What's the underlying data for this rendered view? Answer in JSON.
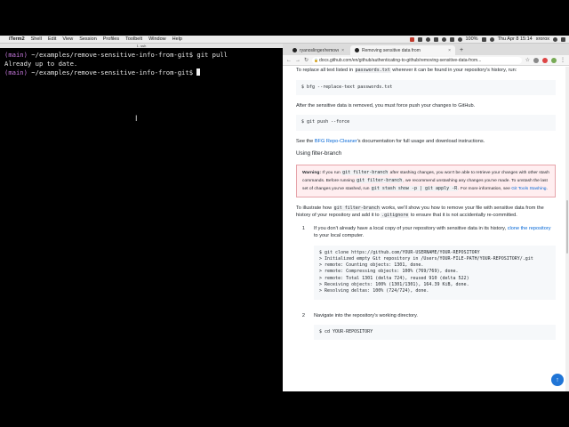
{
  "menubar": {
    "apple": "",
    "app": "iTerm2",
    "items": [
      "Shell",
      "Edit",
      "View",
      "Session",
      "Profiles",
      "Toolbelt",
      "Window",
      "Help"
    ],
    "battery": "100%",
    "clock": "Thu Apr 8  15:14",
    "user": "xrorox"
  },
  "terminal": {
    "title": "1. ssh",
    "lines": [
      {
        "branch": "(main)",
        "path": " ~/examples/remove-sensitive-info-from-git$",
        "cmd": " git pull"
      },
      {
        "text": "Already up to date."
      },
      {
        "branch": "(main)",
        "path": " ~/examples/remove-sensitive-info-from-git$",
        "cmd": " "
      }
    ]
  },
  "browser": {
    "tabs": [
      {
        "label": "ryanoslinger/remove-sensiti"
      },
      {
        "label": "Removing sensitive data from"
      }
    ],
    "url": "docs.github.com/en/github/authenticating-to-github/removing-sensitive-data-from...",
    "content": {
      "p1_pre": "To replace all text listed in ",
      "p1_code": "passwords.txt",
      "p1_post": " wherever it can be found in your repository's history, run:",
      "code1": "$ bfg --replace-text passwords.txt",
      "p2": "After the sensitive data is removed, you must force push your changes to GitHub.",
      "code2": "$ git push --force",
      "p3_pre": "See the ",
      "p3_link": "BFG Repo-Cleaner",
      "p3_post": "'s documentation for full usage and download instructions.",
      "h_filter": "Using filter-branch",
      "warn_label": "Warning:",
      "warn_1": " If you run ",
      "warn_code1": "git filter-branch",
      "warn_2": " after stashing changes, you won't be able to retrieve your changes with other stash commands. Before running ",
      "warn_code2": "git filter-branch",
      "warn_3": ", we recommend unstashing any changes you've made. To unstash the last set of changes you've stashed, run ",
      "warn_code3": "git stash show -p | git apply -R",
      "warn_4": ". For more information, see ",
      "warn_link": "Git Tools Stashing",
      "warn_5": ".",
      "p4_pre": "To illustrate how ",
      "p4_code1": "git filter-branch",
      "p4_mid": " works, we'll show you how to remove your file with sensitive data from the history of your repository and add it to ",
      "p4_code2": ".gitignore",
      "p4_post": " to ensure that it is not accidentally re-committed.",
      "step1_num": "1",
      "step1_pre": "If you don't already have a local copy of your repository with sensitive data in its history, ",
      "step1_link": "clone the repository",
      "step1_post": " to your local computer.",
      "code3": "$ git clone https://github.com/YOUR-USERNAME/YOUR-REPOSITORY\n> Initialized empty Git repository in /Users/YOUR-FILE-PATH/YOUR-REPOSITORY/.git\n> remote: Counting objects: 1301, done.\n> remote: Compressing objects: 100% (769/769), done.\n> remote: Total 1301 (delta 724), reused 910 (delta 522)\n> Receiving objects: 100% (1301/1301), 164.39 KiB, done.\n> Resolving deltas: 100% (724/724), done.",
      "step2_num": "2",
      "step2_text": "Navigate into the repository's working directory.",
      "code4": "$ cd YOUR-REPOSITORY"
    }
  }
}
